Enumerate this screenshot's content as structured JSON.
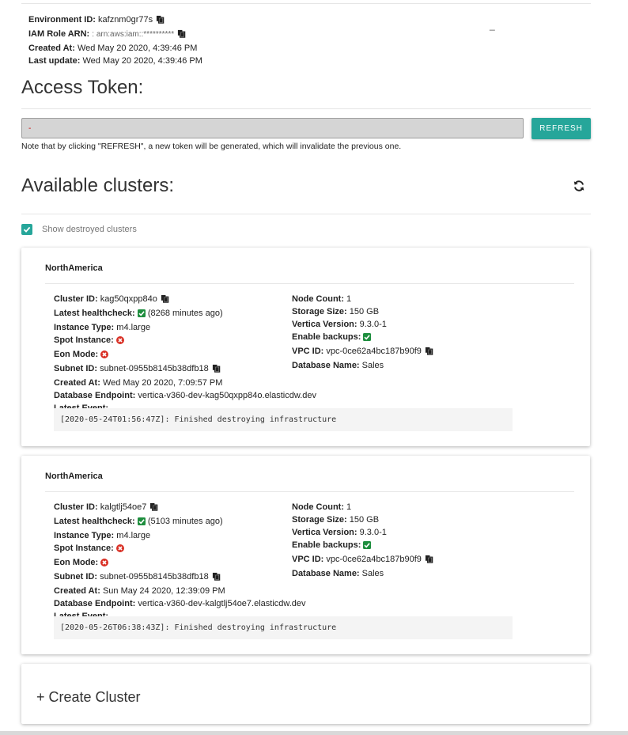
{
  "env": {
    "environment_id_label": "Environment ID:",
    "environment_id": "kafznm0gr77s",
    "iam_role_label": "IAM Role ARN:",
    "iam_role_value": ": arn:aws:iam::**********",
    "created_label": "Created At:",
    "created_value": "Wed May 20 2020, 4:39:46 PM",
    "updated_label": "Last update:",
    "updated_value": "Wed May 20 2020, 4:39:46 PM",
    "dash": "_"
  },
  "token": {
    "title": "Access Token:",
    "value": "-",
    "refresh_label": "REFRESH",
    "note": "Note that by clicking \"REFRESH\", a new token will be generated, which will invalidate the previous one."
  },
  "clusters_section": {
    "title": "Available clusters:",
    "show_destroyed_label": "Show destroyed clusters",
    "show_destroyed_checked": true
  },
  "labels": {
    "cluster_id": "Cluster ID:",
    "healthcheck": "Latest healthcheck:",
    "instance_type": "Instance Type:",
    "spot_instance": "Spot Instance:",
    "eon_mode": "Eon Mode:",
    "subnet_id": "Subnet ID:",
    "created_at": "Created At:",
    "endpoint": "Database Endpoint:",
    "latest_event": "Latest Event:",
    "node_count": "Node Count:",
    "storage_size": "Storage Size:",
    "vertica_version": "Vertica Version:",
    "enable_backups": "Enable backups:",
    "vpc_id": "VPC ID:",
    "database_name": "Database Name:"
  },
  "clusters": [
    {
      "region": "NorthAmerica",
      "cluster_id": "kag50qxpp84o",
      "healthcheck": "(8268 minutes ago)",
      "instance_type": "m4.large",
      "subnet_id": "subnet-0955b8145b38dfb18",
      "created_at": "Wed May 20 2020, 7:09:57 PM",
      "endpoint": "vertica-v360-dev-kag50qxpp84o.elasticdw.dev",
      "node_count": "1",
      "storage_size": "150 GB",
      "vertica_version": "9.3.0-1",
      "vpc_id": "vpc-0ce62a4bc187b90f9",
      "database_name": "Sales",
      "latest_event": "[2020-05-24T01:56:47Z]: Finished destroying infrastructure"
    },
    {
      "region": "NorthAmerica",
      "cluster_id": "kalgtlj54oe7",
      "healthcheck": "(5103 minutes ago)",
      "instance_type": "m4.large",
      "subnet_id": "subnet-0955b8145b38dfb18",
      "created_at": "Sun May 24 2020, 12:39:09 PM",
      "endpoint": "vertica-v360-dev-kalgtlj54oe7.elasticdw.dev",
      "node_count": "1",
      "storage_size": "150 GB",
      "vertica_version": "9.3.0-1",
      "vpc_id": "vpc-0ce62a4bc187b90f9",
      "database_name": "Sales",
      "latest_event": "[2020-05-26T06:38:43Z]: Finished destroying infrastructure"
    }
  ],
  "create_cluster_label": "+ Create Cluster",
  "colors": {
    "accent": "#26a69a",
    "ok": "#1e8e3e",
    "error": "#d93025"
  }
}
